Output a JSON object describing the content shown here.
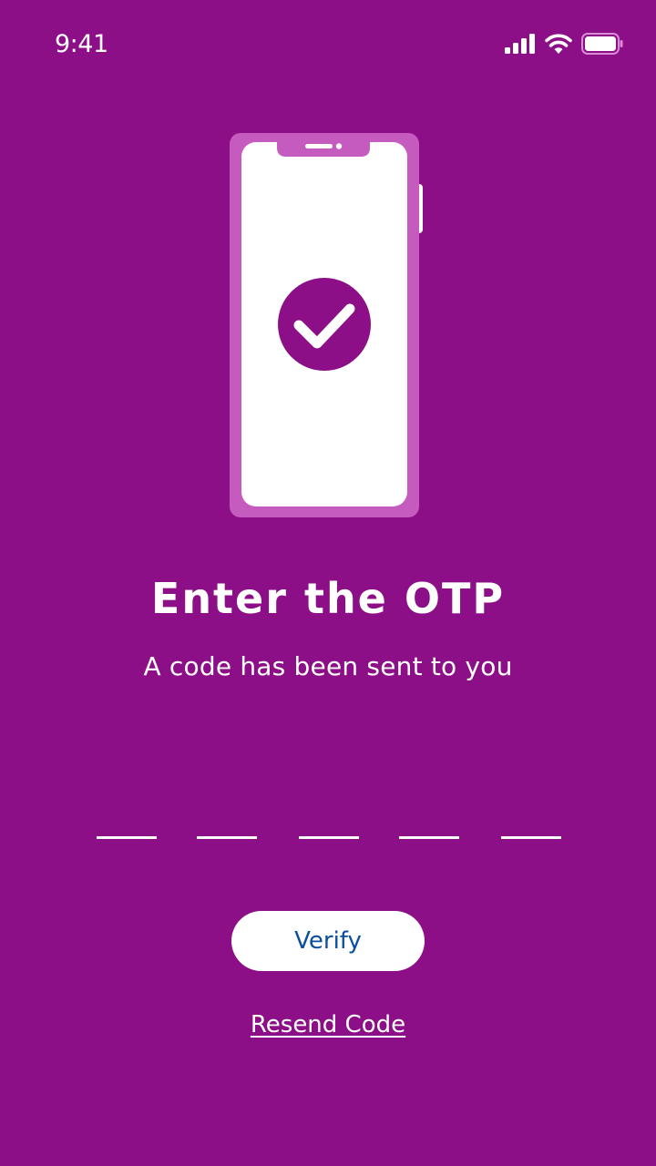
{
  "status_bar": {
    "time": "9:41",
    "icons": [
      "cellular-signal-icon",
      "wifi-icon",
      "battery-icon"
    ]
  },
  "illustration": {
    "icon": "phone-check-icon",
    "colors": {
      "phone_frame": "#c65bbf",
      "phone_screen": "#ffffff",
      "check_circle": "#8c0f87"
    }
  },
  "content": {
    "title": "Enter the OTP",
    "subtitle": "A code has been sent to you"
  },
  "otp": {
    "slots": [
      "",
      "",
      "",
      "",
      ""
    ]
  },
  "actions": {
    "verify_label": "Verify",
    "resend_label": "Resend Code"
  },
  "colors": {
    "background": "#8c0f87",
    "button_text": "#0a4f9e",
    "text": "#ffffff"
  }
}
